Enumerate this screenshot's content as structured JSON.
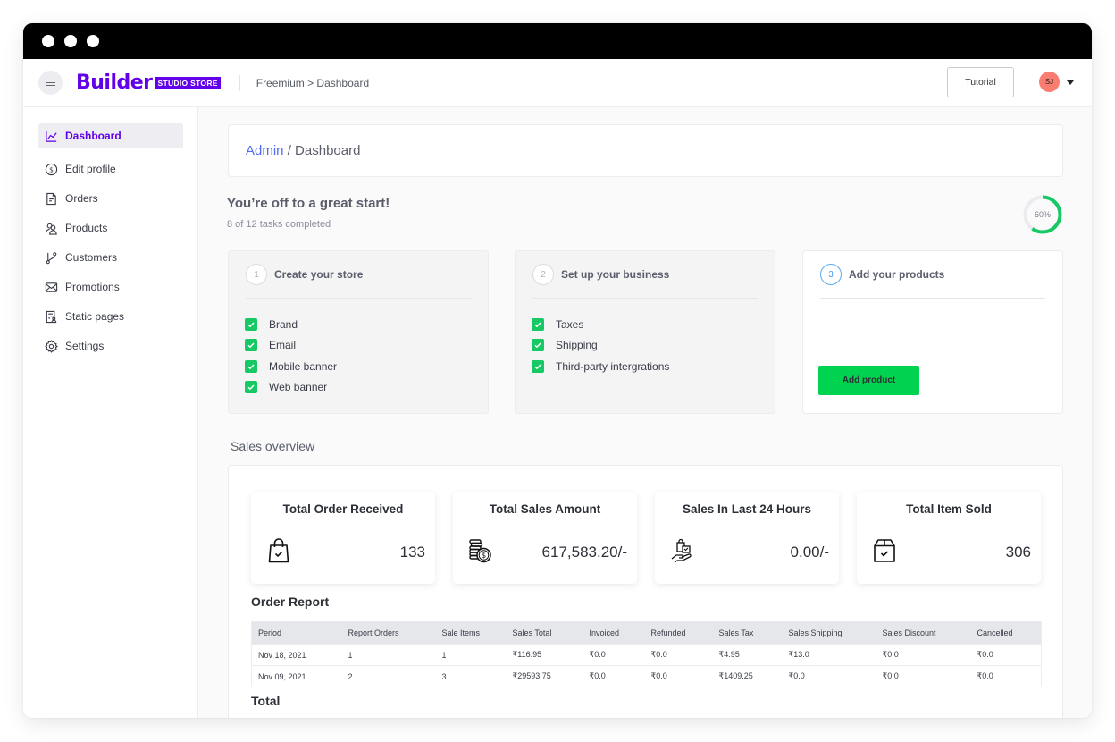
{
  "header": {
    "logo_text": "Builder",
    "logo_badge": "STUDIO STORE",
    "breadcrumb": "Freemium > Dashboard",
    "tutorial_label": "Tutorial",
    "avatar_initials": "SJ"
  },
  "sidebar": {
    "items": [
      {
        "label": "Dashboard",
        "icon": "chart-line-icon",
        "active": true
      },
      {
        "label": "Edit profile",
        "icon": "dollar-circle-icon"
      },
      {
        "label": "Orders",
        "icon": "document-icon"
      },
      {
        "label": "Products",
        "icon": "users-icon"
      },
      {
        "label": "Customers",
        "icon": "git-branch-icon"
      },
      {
        "label": "Promotions",
        "icon": "mail-icon"
      },
      {
        "label": "Static pages",
        "icon": "page-user-icon"
      },
      {
        "label": "Settings",
        "icon": "gear-icon"
      }
    ]
  },
  "page": {
    "crumb_admin": "Admin",
    "crumb_sep": " / ",
    "crumb_current": "Dashboard"
  },
  "progress": {
    "title": "You’re off to a great start!",
    "subtitle": "8 of 12 tasks completed",
    "percent_label": "60%",
    "percent": 60
  },
  "steps": [
    {
      "num": "1",
      "title": "Create your store",
      "items": [
        "Brand",
        "Email",
        "Mobile banner",
        "Web banner"
      ]
    },
    {
      "num": "2",
      "title": "Set up your business",
      "items": [
        "Taxes",
        "Shipping",
        "Third-party intergrations"
      ]
    },
    {
      "num": "3",
      "title": "Add your products",
      "button": "Add product"
    }
  ],
  "sales": {
    "section_title": "Sales overview",
    "stats": [
      {
        "title": "Total Order Received",
        "value": "133",
        "icon": "shopping-bag-check-icon"
      },
      {
        "title": "Total Sales Amount",
        "value": "617,583.20/-",
        "icon": "coins-stack-icon"
      },
      {
        "title": "Sales In Last 24 Hours",
        "value": "0.00/-",
        "icon": "hand-shopping-bag-icon"
      },
      {
        "title": "Total Item Sold",
        "value": "306",
        "icon": "box-check-icon"
      }
    ],
    "report_title": "Order Report",
    "columns": [
      "Period",
      "Report Orders",
      "Sale Items",
      "Sales Total",
      "Invoiced",
      "Refunded",
      "Sales Tax",
      "Sales Shipping",
      "Sales Discount",
      "Cancelled"
    ],
    "rows": [
      [
        "Nov 18, 2021",
        "1",
        "1",
        "₹116.95",
        "₹0.0",
        "₹0.0",
        "₹4.95",
        "₹13.0",
        "₹0.0",
        "₹0.0"
      ],
      [
        "Nov 09, 2021",
        "2",
        "3",
        "₹29593.75",
        "₹0.0",
        "₹0.0",
        "₹1409.25",
        "₹0.0",
        "₹0.0",
        "₹0.0"
      ]
    ],
    "total_label": "Total"
  },
  "colors": {
    "brand": "#6200ea",
    "accent_blue": "#4f6df5",
    "success_green": "#17c964",
    "button_green": "#00d34f",
    "avatar_bg": "#fb7c70"
  }
}
